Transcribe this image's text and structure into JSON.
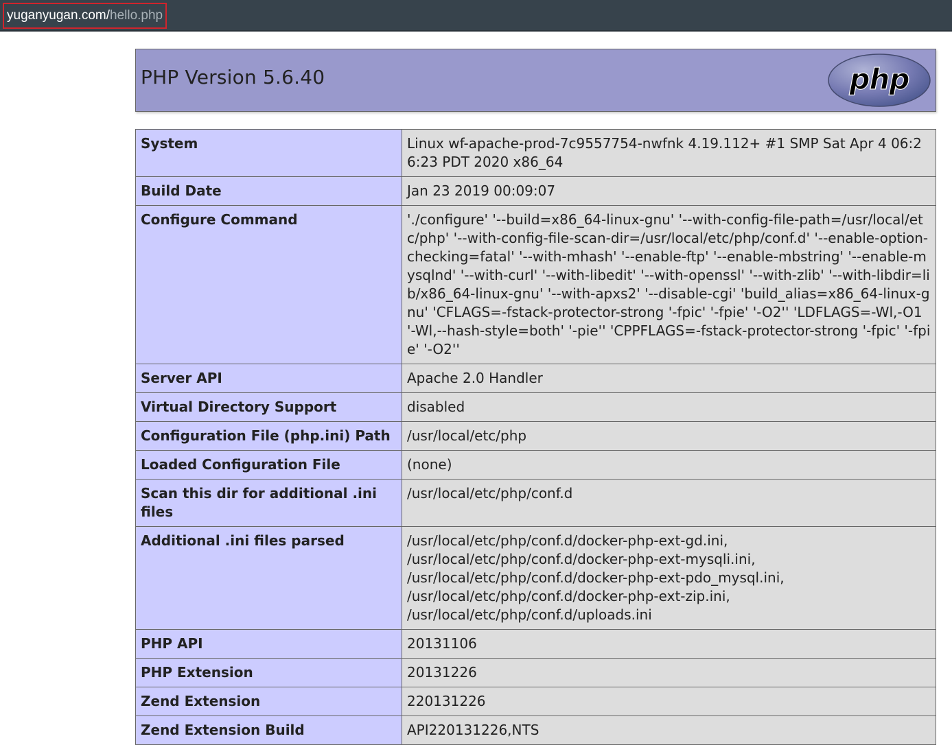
{
  "browser": {
    "url_host": "yuganyugan.com/",
    "url_path": "hello.php"
  },
  "header": {
    "title": "PHP Version 5.6.40",
    "logo_text": "php"
  },
  "rows": [
    {
      "key": "System",
      "value": "Linux wf-apache-prod-7c9557754-nwfnk 4.19.112+ #1 SMP Sat Apr 4 06:26:23 PDT 2020 x86_64"
    },
    {
      "key": "Build Date",
      "value": "Jan 23 2019 00:09:07"
    },
    {
      "key": "Configure Command",
      "value": "'./configure' '--build=x86_64-linux-gnu' '--with-config-file-path=/usr/local/etc/php' '--with-config-file-scan-dir=/usr/local/etc/php/conf.d' '--enable-option-checking=fatal' '--with-mhash' '--enable-ftp' '--enable-mbstring' '--enable-mysqlnd' '--with-curl' '--with-libedit' '--with-openssl' '--with-zlib' '--with-libdir=lib/x86_64-linux-gnu' '--with-apxs2' '--disable-cgi' 'build_alias=x86_64-linux-gnu' 'CFLAGS=-fstack-protector-strong '-fpic' '-fpie' '-O2'' 'LDFLAGS=-Wl,-O1 '-Wl,--hash-style=both' '-pie'' 'CPPFLAGS=-fstack-protector-strong '-fpic' '-fpie' '-O2''"
    },
    {
      "key": "Server API",
      "value": "Apache 2.0 Handler"
    },
    {
      "key": "Virtual Directory Support",
      "value": "disabled"
    },
    {
      "key": "Configuration File (php.ini) Path",
      "value": "/usr/local/etc/php"
    },
    {
      "key": "Loaded Configuration File",
      "value": "(none)"
    },
    {
      "key": "Scan this dir for additional .ini files",
      "value": "/usr/local/etc/php/conf.d"
    },
    {
      "key": "Additional .ini files parsed",
      "value_lines": [
        "/usr/local/etc/php/conf.d/docker-php-ext-gd.ini,",
        "/usr/local/etc/php/conf.d/docker-php-ext-mysqli.ini,",
        "/usr/local/etc/php/conf.d/docker-php-ext-pdo_mysql.ini,",
        "/usr/local/etc/php/conf.d/docker-php-ext-zip.ini,",
        "/usr/local/etc/php/conf.d/uploads.ini"
      ]
    },
    {
      "key": "PHP API",
      "value": "20131106"
    },
    {
      "key": "PHP Extension",
      "value": "20131226"
    },
    {
      "key": "Zend Extension",
      "value": "220131226"
    },
    {
      "key": "Zend Extension Build",
      "value": "API220131226,NTS"
    }
  ],
  "colors": {
    "header_bg": "#9999cc",
    "key_bg": "#ccccff",
    "value_bg": "#dddddd",
    "url_highlight": "#d0242c"
  }
}
